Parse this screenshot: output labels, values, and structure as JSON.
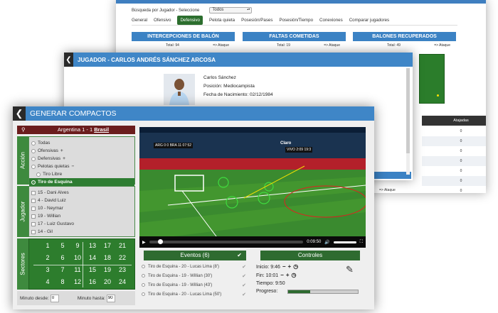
{
  "search_window": {
    "search_label": "Búsqueda por Jugador - Seleccione",
    "search_select": "Todos",
    "tabs": [
      "General",
      "Ofensivo",
      "Defensivo",
      "Pelota quieta",
      "Posesión/Pases",
      "Posesión/Tiempo",
      "Conexiones",
      "Comparar jugadores"
    ],
    "active_tab": "Defensivo",
    "stats": [
      {
        "title": "INTERCEPCIONES DE BALÓN",
        "total": "Total: 94",
        "link": "=> Ataque"
      },
      {
        "title": "FALTAS COMETIDAS",
        "total": "Total: 19",
        "link": "=> Ataque"
      },
      {
        "title": "BALONES RECUPERADOS",
        "total": "Total: 49",
        "link": "=> Ataque"
      }
    ],
    "extra_link": "=> Ataque",
    "table_header": "Atajadas",
    "table_values": [
      "0",
      "0",
      "0",
      "0",
      "0",
      "0",
      "0"
    ]
  },
  "player_window": {
    "title": "JUGADOR - CARLOS ANDRÉS SÁNCHEZ ARCOSA",
    "name": "Carlos Sánchez",
    "position": "Posición: Mediocampista",
    "birthdate": "Fecha de Nacimiento: 02/12/1984"
  },
  "compact_window": {
    "title": "GENERAR COMPACTOS",
    "match": {
      "home": "Argentina 1 - 1",
      "away": "Brasil"
    },
    "sections": {
      "accion": "Acción",
      "jugador": "Jugador",
      "sectores": "Sectores"
    },
    "actions": [
      {
        "label": "Todas",
        "plus": ""
      },
      {
        "label": "Ofensivas",
        "plus": "+"
      },
      {
        "label": "Defensivas",
        "plus": "+"
      },
      {
        "label": "Pelotas quietas",
        "plus": "−"
      },
      {
        "label": "Tiro Libre",
        "plus": ""
      },
      {
        "label": "Tiro de Esquina",
        "plus": ""
      }
    ],
    "players": [
      "15 - Dani Alves",
      "4 - David Luiz",
      "10 - Neymar",
      "19 - Willian",
      "17 - Luiz Gustavo",
      "14 - Gil"
    ],
    "sectors": [
      [
        "1",
        "5",
        "9",
        "13",
        "17",
        "21"
      ],
      [
        "2",
        "6",
        "10",
        "14",
        "18",
        "22"
      ],
      [
        "3",
        "7",
        "11",
        "15",
        "19",
        "23"
      ],
      [
        "4",
        "8",
        "12",
        "16",
        "20",
        "24"
      ]
    ],
    "minute_from_label": "Minuto desde:",
    "minute_from": "0",
    "minute_to_label": "Minuto hasta:",
    "minute_to": "90",
    "video": {
      "time": "0:09:50",
      "score_left": "ARG 0 0 BRA",
      "clock_left": "11 07:52",
      "live": "VIVO",
      "clock_right": "2:09 19:3",
      "brand": "Claro"
    },
    "events_title": "Eventos (6)",
    "events": [
      "Tiro de Esquina - 20 - Lucas Lima (8')",
      "Tiro de Esquina - 19 - Willian (30')",
      "Tiro de Esquina - 19 - Willian (43')",
      "Tiro de Esquina - 20 - Lucas Lima (50')"
    ],
    "controls_title": "Controles",
    "start_label": "Inicio: 9:46",
    "end_label": "Fin: 10:01",
    "time_label": "Tiempo: 9:50",
    "progress_label": "Progreso:",
    "progress": 0.32
  }
}
